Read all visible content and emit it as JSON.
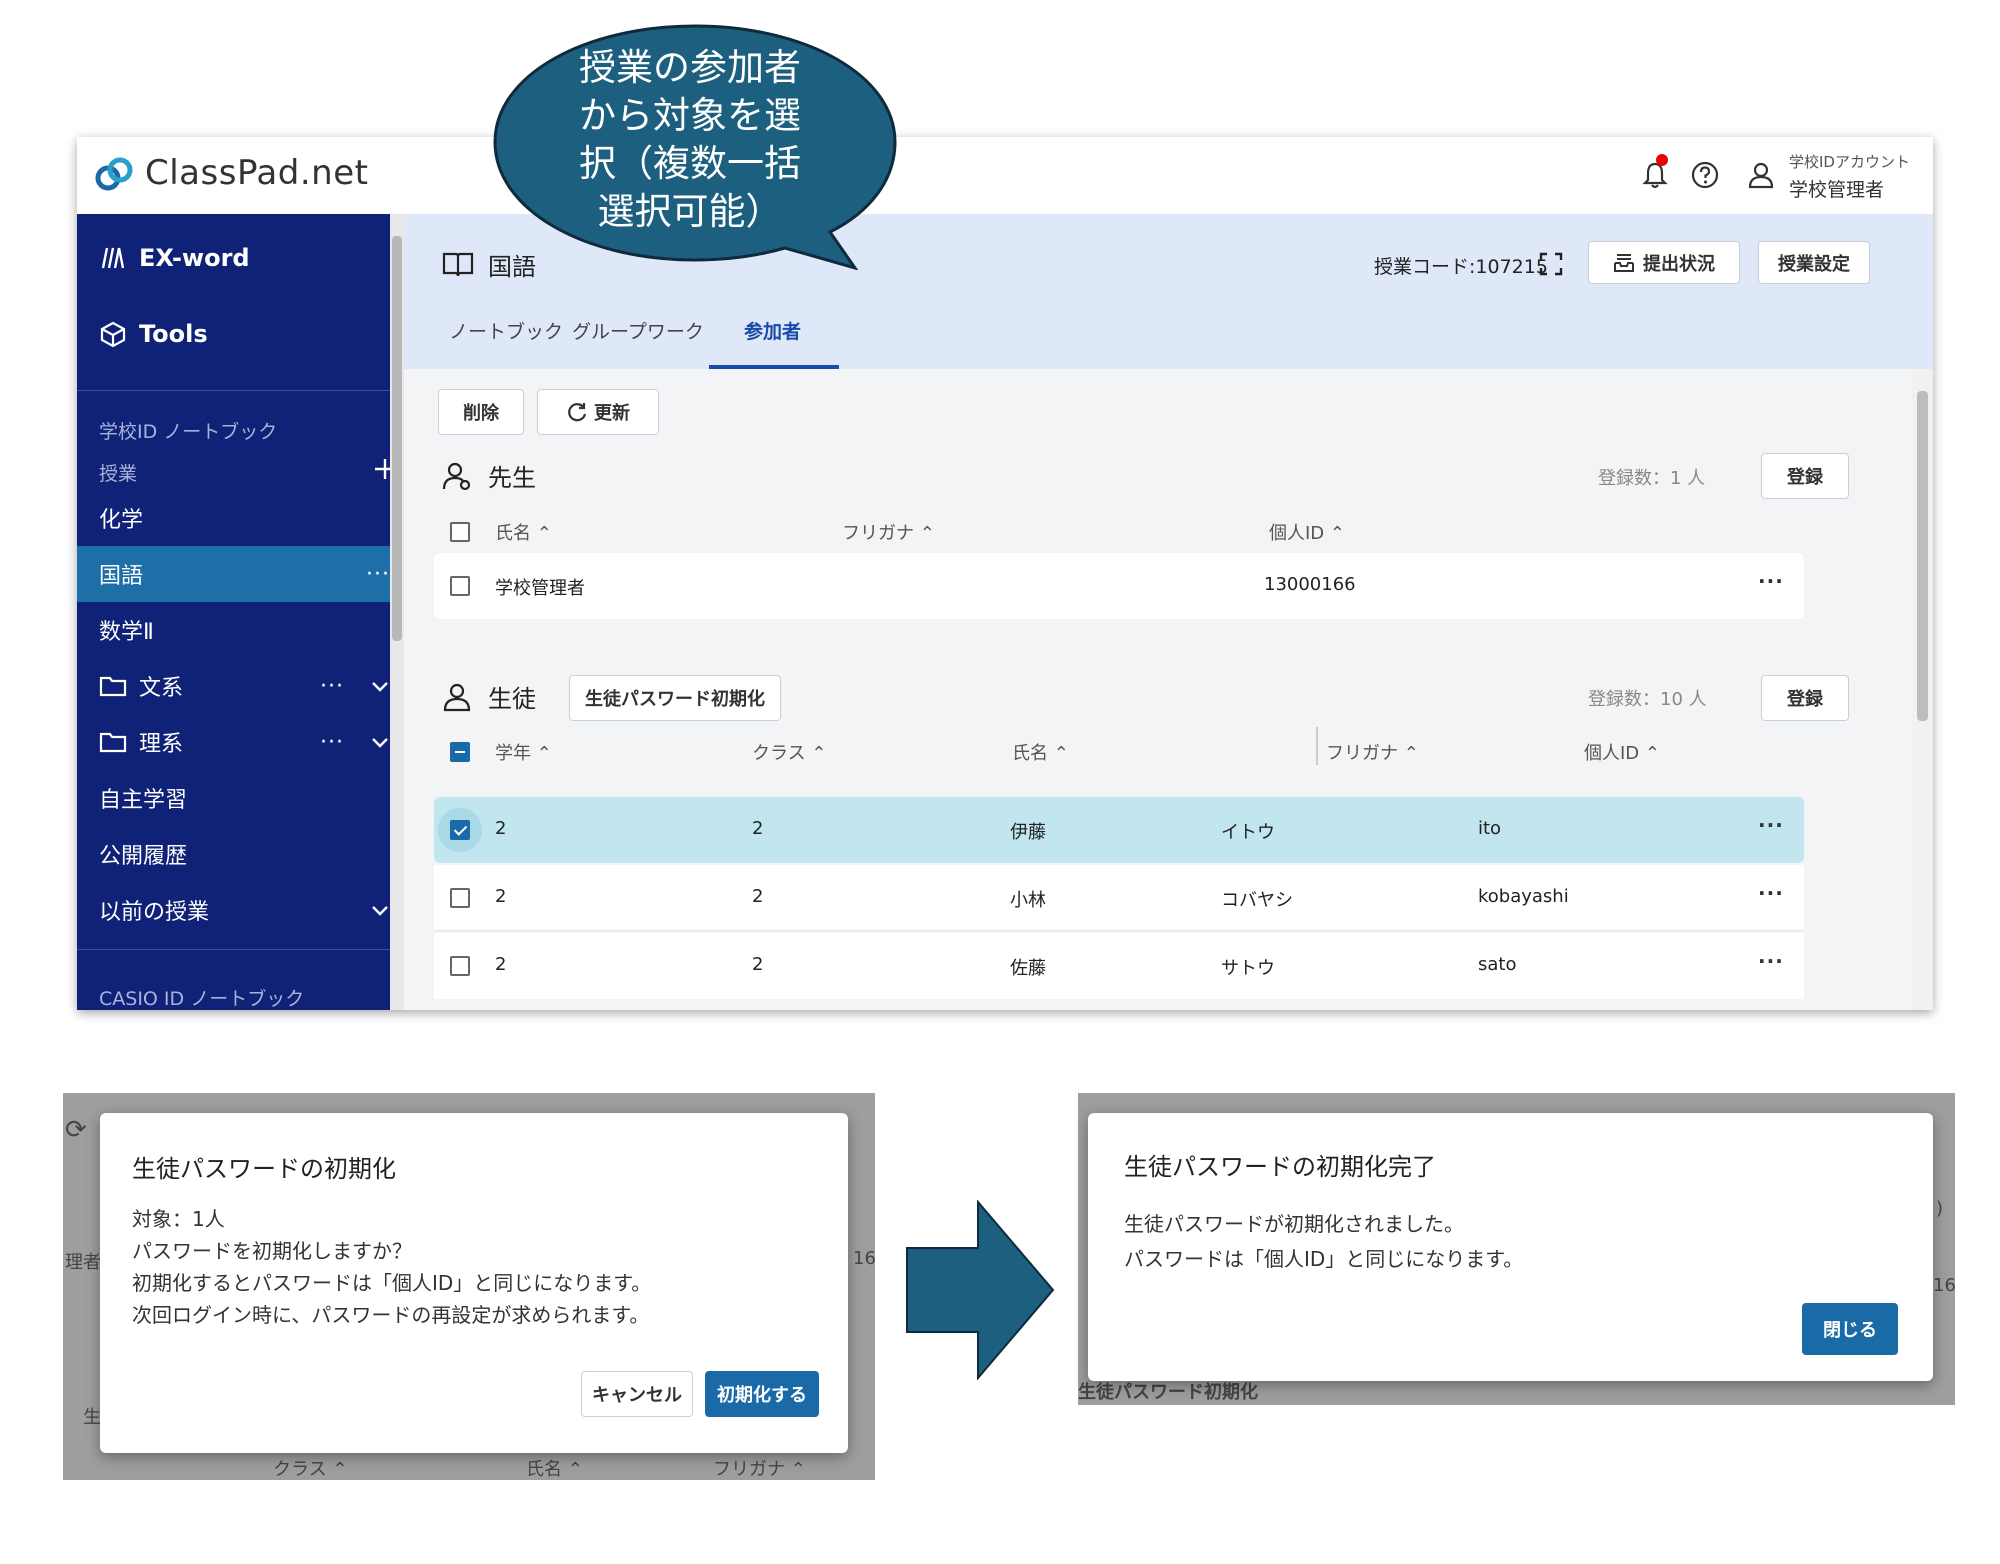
{
  "app": {
    "brand": "ClassPad.net",
    "account_label": "学校IDアカウント",
    "account_name": "学校管理者"
  },
  "callout": {
    "lines": [
      "授業の参加者",
      "から対象を選",
      "択（複数一括",
      "選択可能）"
    ]
  },
  "sidebar": {
    "apps": [
      "EX-word",
      "Tools"
    ],
    "section_school": "学校ID ノートブック",
    "section_class": "授業",
    "items": [
      "化学",
      "国語",
      "数学Ⅱ"
    ],
    "folders": [
      "文系",
      "理系"
    ],
    "extra": [
      "自主学習",
      "公開履歴",
      "以前の授業"
    ],
    "section_casio": "CASIO ID ノートブック",
    "more": "···"
  },
  "course": {
    "title": "国語",
    "code": "授業コード:107215",
    "submission_btn": "提出状況",
    "settings_btn": "授業設定",
    "tabs": [
      "ノートブック",
      "グループワーク",
      "参加者"
    ]
  },
  "actions": {
    "delete": "削除",
    "refresh": "更新"
  },
  "teachers": {
    "title": "先生",
    "count": "登録数：1 人",
    "register": "登録",
    "headers": [
      "氏名 ⌃",
      "フリガナ ⌃",
      "個人ID ⌃"
    ],
    "rows": [
      {
        "name": "学校管理者",
        "id": "13000166"
      }
    ]
  },
  "students": {
    "title": "生徒",
    "reset_btn": "生徒パスワード初期化",
    "count": "登録数：10 人",
    "register": "登録",
    "headers": [
      "学年 ⌃",
      "クラス ⌃",
      "氏名 ⌃",
      "フリガナ ⌃",
      "個人ID ⌃"
    ],
    "rows": [
      {
        "grade": "2",
        "class": "2",
        "name": "伊藤",
        "kana": "イトウ",
        "id": "ito"
      },
      {
        "grade": "2",
        "class": "2",
        "name": "小林",
        "kana": "コバヤシ",
        "id": "kobayashi"
      },
      {
        "grade": "2",
        "class": "2",
        "name": "佐藤",
        "kana": "サトウ",
        "id": "sato"
      }
    ]
  },
  "dialog_confirm": {
    "title": "生徒パスワードの初期化",
    "lines": [
      "対象：1人",
      "パスワードを初期化しますか？",
      "初期化するとパスワードは「個人ID」と同じになります。",
      "次回ログイン時に、パスワードの再設定が求められます。"
    ],
    "cancel": "キャンセル",
    "ok": "初期化する",
    "bg": {
      "class": "クラス ⌃",
      "name": "氏名 ⌃",
      "kana": "フリガナ ⌃",
      "admin": "理者",
      "num": "16",
      "stu": "生"
    }
  },
  "dialog_done": {
    "title": "生徒パスワードの初期化完了",
    "lines": [
      "生徒パスワードが初期化されました。",
      "パスワードは「個人ID」と同じになります。"
    ],
    "close": "閉じる",
    "bg": {
      "reset": "生徒パスワード初期化",
      "num": "16"
    }
  },
  "colors": {
    "sidebar": "#0f2277",
    "active": "#1c6fa7",
    "accent": "#1b6aa8",
    "callout": "#1c5f7e"
  }
}
